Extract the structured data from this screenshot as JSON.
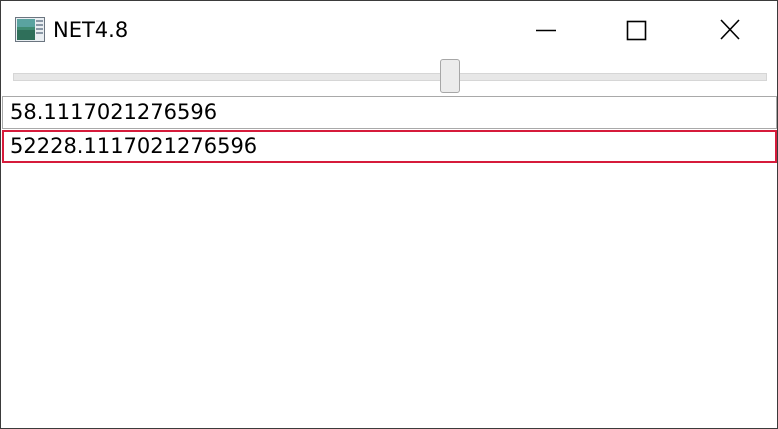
{
  "window": {
    "title": "NET4.8",
    "icon": "app-window-icon",
    "controls": {
      "minimize_icon": "minimize-icon",
      "maximize_icon": "maximize-icon",
      "close_icon": "close-icon"
    }
  },
  "slider": {
    "value_fraction": 0.581
  },
  "textboxes": [
    {
      "value": "58.1117021276596"
    },
    {
      "value": "52228.1117021276596",
      "state": "validation-error"
    }
  ],
  "colors": {
    "error_border": "#d61b3b",
    "slider_thumb": "#ececec"
  }
}
